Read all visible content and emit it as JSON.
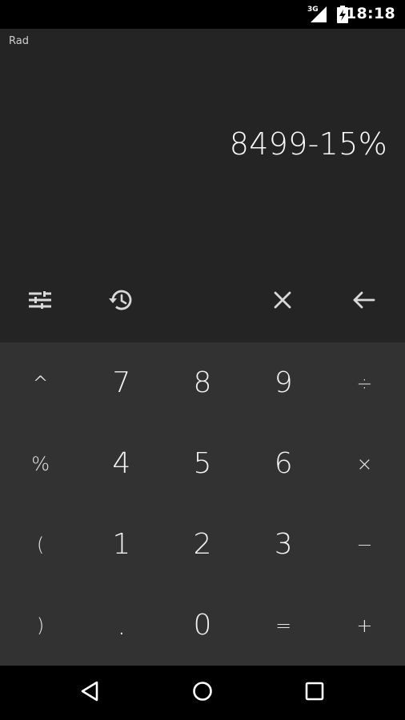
{
  "status_bar": {
    "network": "3G",
    "time": "18:18"
  },
  "display": {
    "mode": "Rad",
    "expression": "8499-15%"
  },
  "toolbar": {
    "items": [
      {
        "icon": "sliders-icon"
      },
      {
        "icon": "history-icon"
      },
      {
        "icon": "clear-icon"
      },
      {
        "icon": "backspace-icon"
      }
    ]
  },
  "keypad": {
    "keys": [
      "^",
      "7",
      "8",
      "9",
      "÷",
      "%",
      "4",
      "5",
      "6",
      "×",
      "(",
      "1",
      "2",
      "3",
      "−",
      ")",
      ".",
      "0",
      "=",
      "+"
    ]
  },
  "nav_bar": {
    "items": [
      {
        "icon": "back-triangle-icon"
      },
      {
        "icon": "home-circle-icon"
      },
      {
        "icon": "recents-square-icon"
      }
    ]
  },
  "colors": {
    "status_bg": "#000000",
    "display_bg": "#242424",
    "keypad_bg": "#323232",
    "text": "#f2f2f2"
  }
}
